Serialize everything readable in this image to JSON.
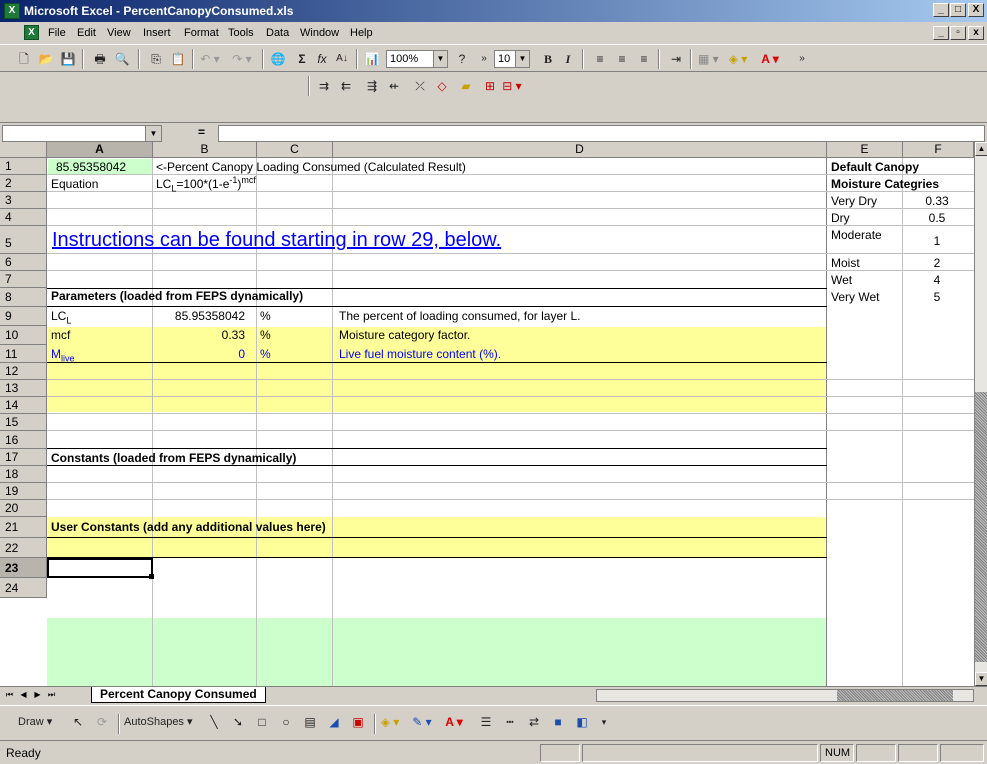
{
  "window": {
    "title": "Microsoft Excel - PercentCanopyConsumed.xls",
    "minimize": "_",
    "restore": "□",
    "close": "X"
  },
  "menu": [
    "File",
    "Edit",
    "View",
    "Insert",
    "Format",
    "Tools",
    "Data",
    "Window",
    "Help"
  ],
  "toolbar": {
    "zoom": "100%",
    "font_size": "10",
    "bold": "B",
    "italic": "I"
  },
  "formula_bar": {
    "name_box": "",
    "equals": "=",
    "content": ""
  },
  "columns": [
    "A",
    "B",
    "C",
    "D",
    "E",
    "F"
  ],
  "rows": [
    "1",
    "2",
    "3",
    "4",
    "5",
    "6",
    "7",
    "8",
    "9",
    "10",
    "11",
    "12",
    "13",
    "14",
    "15",
    "16",
    "17",
    "18",
    "19",
    "20",
    "21",
    "22",
    "23",
    "24"
  ],
  "selected_row": "23",
  "cells": {
    "a1": "85.95358042",
    "b1": "<-Percent Canopy Loading Consumed (Calculated Result)",
    "a2": "Equation",
    "b2": "LC",
    "b2_sub": "L",
    "b2_rest": "=100*(1-e",
    "b2_sup": "-1",
    "b2_end": ")",
    "b2_sup2": "mcf",
    "a5": "Instructions can be found starting in row 29, below.",
    "a7": "Parameters (loaded from FEPS dynamically)",
    "a8": "LC",
    "a8_sub": "L",
    "b8": "85.95358042",
    "c8": "%",
    "d8": "The percent of loading consumed, for layer L.",
    "a9": "mcf",
    "b9": "0.33",
    "c9": "%",
    "d9": "Moisture category factor.",
    "a10": "M",
    "a10_sub": "live",
    "b10": "0",
    "c10": "%",
    "d10": "Live fuel moisture content (%).",
    "a16": "Constants (loaded from FEPS dynamically)",
    "a21": "User Constants (add any additional values here)"
  },
  "moisture_table": {
    "title1": "Default Canopy",
    "title2": "Moisture Categries",
    "rows": [
      {
        "label": "Very Dry",
        "value": "0.33"
      },
      {
        "label": "Dry",
        "value": "0.5"
      },
      {
        "label": "Moderate",
        "value": "1"
      },
      {
        "label": "Moist",
        "value": "2"
      },
      {
        "label": "Wet",
        "value": "4"
      },
      {
        "label": "Very Wet",
        "value": "5"
      }
    ]
  },
  "sheet_tab": "Percent Canopy Consumed",
  "drawbar": {
    "draw": "Draw",
    "autoshapes": "AutoShapes"
  },
  "status": {
    "ready": "Ready",
    "num": "NUM"
  },
  "colors": {
    "yellow": "#ffff99",
    "green": "#ccffcc",
    "title": "#0a246a",
    "link": "#0000ff"
  }
}
